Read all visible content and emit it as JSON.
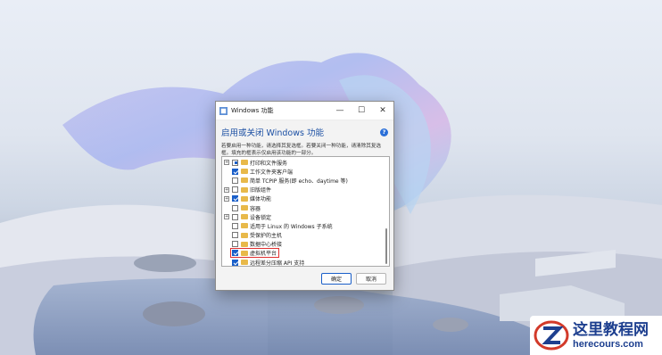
{
  "window": {
    "title": "Windows 功能",
    "minimize_glyph": "—",
    "maximize_glyph": "☐",
    "close_glyph": "✕",
    "heading": "启用或关闭 Windows 功能",
    "help_glyph": "?",
    "description": "若要启用一种功能，请选择其复选框。若要关闭一种功能，请清除其复选框。填充的框表示仅启用该功能的一部分。"
  },
  "features": [
    {
      "label": "打印和文件服务",
      "state": "partial",
      "expandable": true
    },
    {
      "label": "工作文件夹客户端",
      "state": "checked",
      "expandable": false
    },
    {
      "label": "简单 TCPIP 服务(即 echo、daytime 等)",
      "state": "unchecked",
      "expandable": false
    },
    {
      "label": "旧版组件",
      "state": "unchecked",
      "expandable": true
    },
    {
      "label": "媒体功能",
      "state": "checked",
      "expandable": true
    },
    {
      "label": "容器",
      "state": "unchecked",
      "expandable": false
    },
    {
      "label": "设备锁定",
      "state": "unchecked",
      "expandable": true
    },
    {
      "label": "适用于 Linux 的 Windows 子系统",
      "state": "unchecked",
      "expandable": false
    },
    {
      "label": "受保护的主机",
      "state": "unchecked",
      "expandable": false
    },
    {
      "label": "数据中心桥接",
      "state": "unchecked",
      "expandable": false
    },
    {
      "label": "虚拟机平台",
      "state": "checked",
      "expandable": false,
      "highlighted": true
    },
    {
      "label": "远程差分压缩 API 支持",
      "state": "checked",
      "expandable": false
    }
  ],
  "expander_glyph": "+",
  "buttons": {
    "ok": "确定",
    "cancel": "取消"
  },
  "watermark": {
    "title": "这里教程网",
    "url": "herecours.com"
  },
  "colors": {
    "accent": "#1a5fc9",
    "heading": "#1b4fa3",
    "highlight_box": "#e03030",
    "folder": "#e8b94a"
  }
}
